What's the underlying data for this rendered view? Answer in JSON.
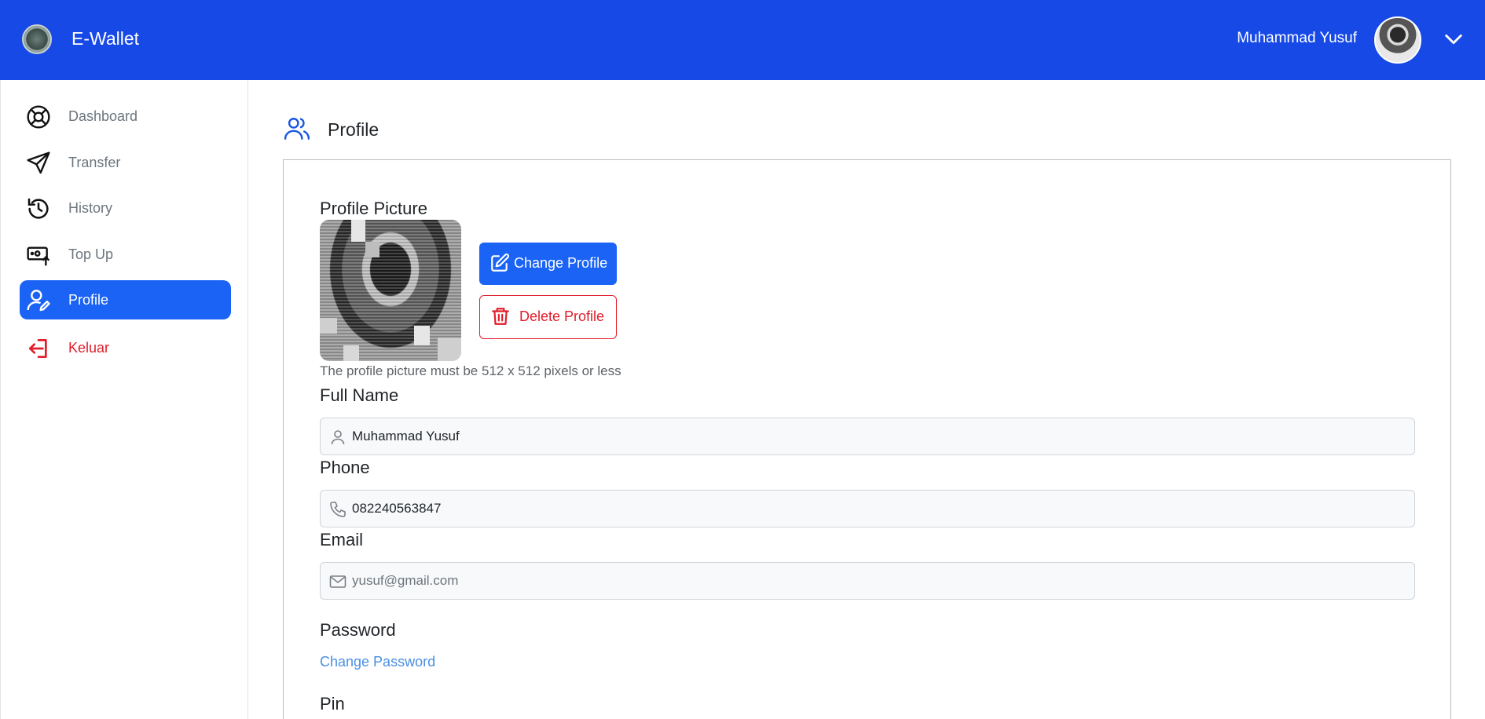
{
  "app": {
    "title": "E-Wallet",
    "logo": "app-logo"
  },
  "header": {
    "user_name": "Muhammad Yusuf",
    "avatar": "user-avatar",
    "menu_icon": "chevron-down-icon"
  },
  "sidebar": {
    "items": [
      {
        "label": "Dashboard",
        "icon": "lifebuoy-icon",
        "active": false
      },
      {
        "label": "Transfer",
        "icon": "send-icon",
        "active": false
      },
      {
        "label": "History",
        "icon": "history-icon",
        "active": false
      },
      {
        "label": "Top Up",
        "icon": "topup-icon",
        "active": false
      },
      {
        "label": "Profile",
        "icon": "user-edit-icon",
        "active": true
      },
      {
        "label": "Keluar",
        "icon": "logout-icon",
        "active": false
      }
    ]
  },
  "page": {
    "title": "Profile",
    "icon": "users-icon"
  },
  "profile": {
    "picture_label": "Profile Picture",
    "change_button": "Change Profile",
    "delete_button": "Delete Profile",
    "hint": "The profile picture must be 512 x 512 pixels or less",
    "fullname_label": "Full Name",
    "fullname_value": "Muhammad Yusuf",
    "phone_label": "Phone",
    "phone_value": "082240563847",
    "email_label": "Email",
    "email_value": "yusuf@gmail.com",
    "password_label": "Password",
    "change_password_link": "Change Password",
    "pin_label": "Pin"
  },
  "colors": {
    "header": "#1749e6",
    "primary": "#1a63f5",
    "danger": "#e11d2a",
    "link": "#4a90e2"
  }
}
